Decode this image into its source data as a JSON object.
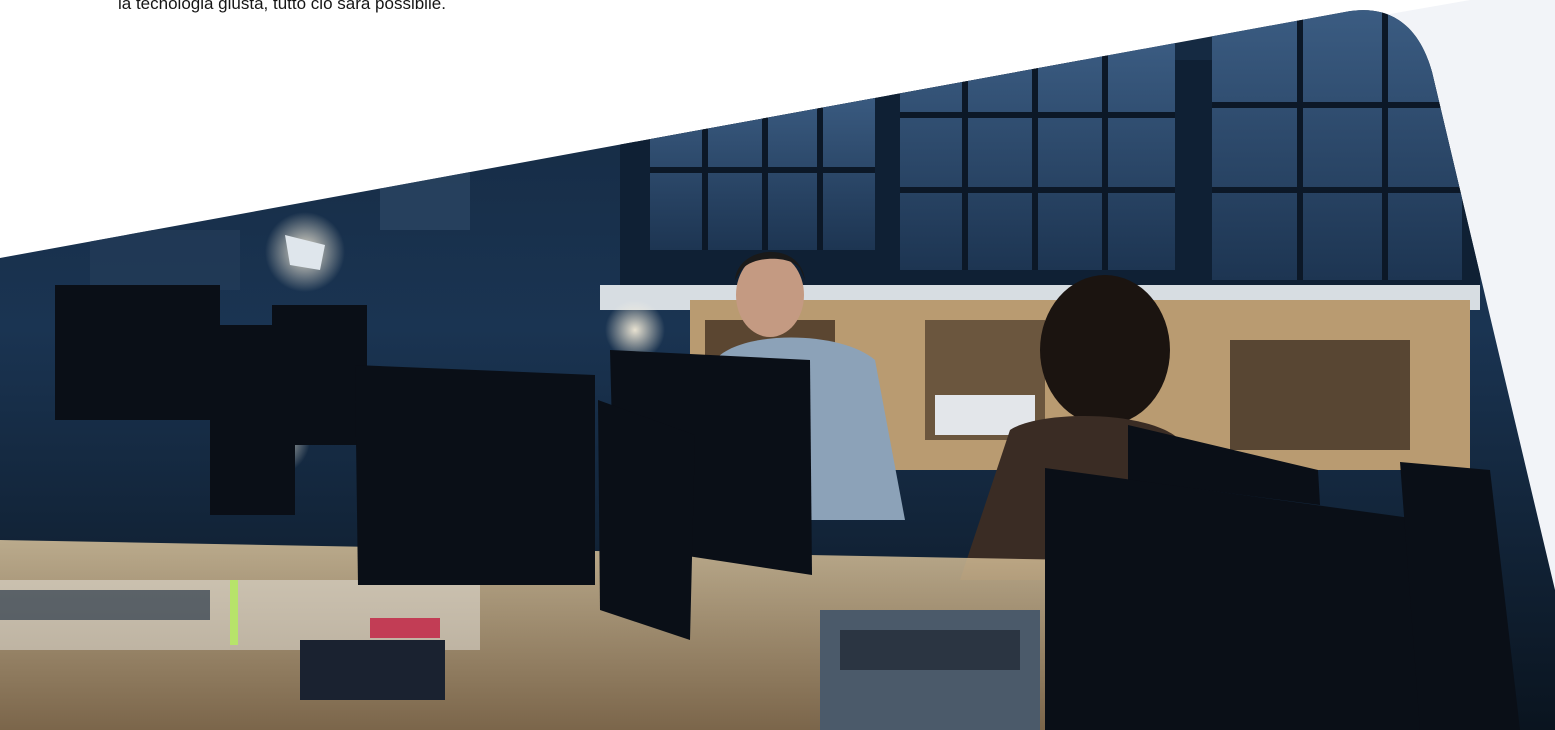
{
  "intro": {
    "text_tail": "la tecnologia giusta, tutto ciò sarà possibile."
  },
  "hero": {
    "image_alt": "Colleagues working late at computer workstations in a dim office",
    "colors": {
      "backdrop": "#f2f4f8",
      "window_light": "#2b4a6e",
      "wall_dark": "#0d1b2a",
      "desk_wood": "#c9a877",
      "monitor": "#0a0f17"
    }
  }
}
